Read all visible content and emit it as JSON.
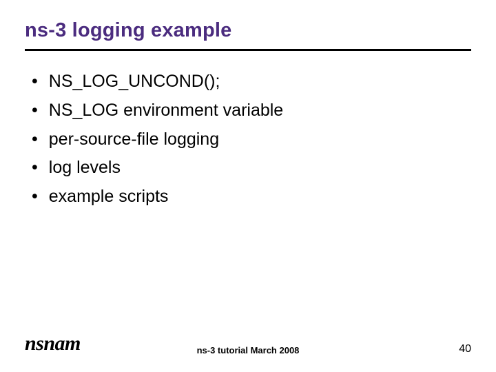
{
  "title": "ns-3 logging example",
  "bullets": [
    "NS_LOG_UNCOND();",
    "NS_LOG environment variable",
    "per-source-file logging",
    "log levels",
    "example scripts"
  ],
  "footer": {
    "logo": "nsnam",
    "center": "ns-3 tutorial March 2008",
    "page": "40"
  }
}
